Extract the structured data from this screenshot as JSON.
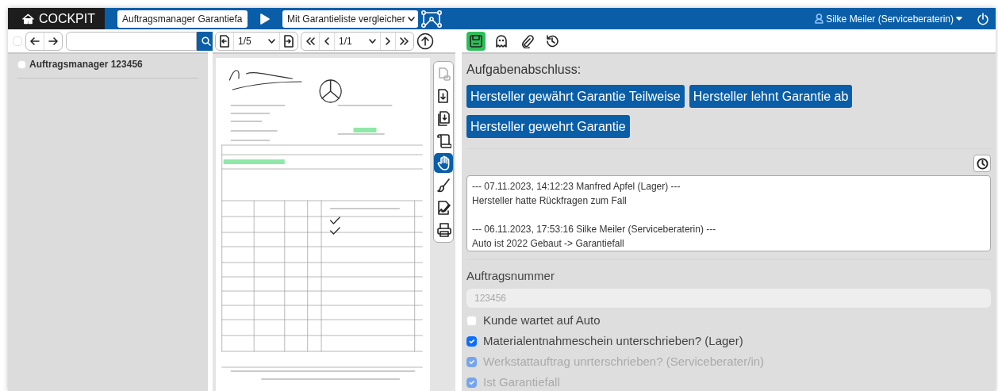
{
  "navbar": {
    "brand": "COCKPIT",
    "process_select": {
      "value": "Auftragsmanager Garantiefa"
    },
    "action_select": {
      "value": "Mit Garantieliste vergleicher"
    },
    "user": "Silke Meiler (Serviceberaterin)"
  },
  "left_panel": {
    "select_all": {
      "checked": false
    },
    "items": [
      {
        "label": "Auftragsmanager 123456",
        "checked": false
      }
    ]
  },
  "viewer": {
    "document_page": "1/5",
    "page": "1/1",
    "tools": [
      {
        "kind": "copy",
        "selected": false,
        "disabled": true
      },
      {
        "kind": "download",
        "selected": false,
        "disabled": false
      },
      {
        "kind": "download-all",
        "selected": false,
        "disabled": false
      },
      {
        "kind": "scroll",
        "selected": false,
        "disabled": false
      },
      {
        "kind": "hand",
        "selected": true,
        "disabled": false
      },
      {
        "kind": "brush",
        "selected": false,
        "disabled": false
      },
      {
        "kind": "sign",
        "selected": false,
        "disabled": false
      },
      {
        "kind": "print",
        "selected": false,
        "disabled": false
      }
    ]
  },
  "right_panel": {
    "toolbar": [
      {
        "kind": "save",
        "selected": true
      },
      {
        "kind": "ghost",
        "selected": false
      },
      {
        "kind": "attach",
        "selected": false
      },
      {
        "kind": "history",
        "selected": false
      }
    ],
    "task_heading": "Aufgabenabschluss:",
    "task_buttons": [
      "Hersteller gewährt Garantie Teilweise",
      "Hersteller lehnt Garantie ab",
      "Hersteller gewehrt Garantie"
    ],
    "history": [
      {
        "header": "--- 07.11.2023, 14:12:23 Manfred Apfel (Lager) ---",
        "text": "Hersteller hatte Rückfragen zum Fall"
      },
      {
        "header": "--- 06.11.2023, 17:53:16 Silke Meiler (Serviceberaterin) ---",
        "text": "Auto ist 2022 Gebaut -> Garantiefall"
      }
    ],
    "order_field": {
      "label": "Auftragsnummer",
      "placeholder": "123456",
      "disabled": true
    },
    "checks": [
      {
        "label": "Kunde wartet auf Auto",
        "checked": false,
        "disabled": false
      },
      {
        "label": "Materialentnahmeschein unterschrieben? (Lager)",
        "checked": true,
        "disabled": false
      },
      {
        "label": "Werkstattauftrag unrterschrieben? (Serviceberater/in)",
        "checked": true,
        "disabled": true
      },
      {
        "label": "Ist Garantiefall",
        "checked": true,
        "disabled": true
      }
    ]
  }
}
